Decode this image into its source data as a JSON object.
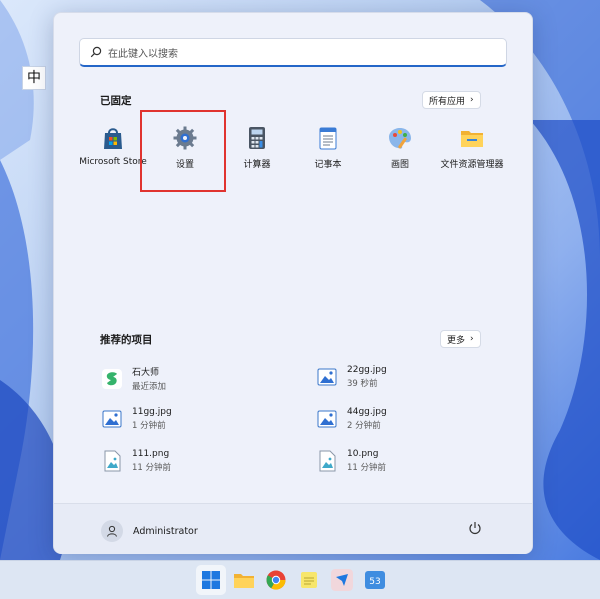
{
  "ime": {
    "label": "中"
  },
  "search": {
    "placeholder": "在此键入以搜索"
  },
  "pinned": {
    "title": "已固定",
    "all_apps_label": "所有应用",
    "apps": [
      {
        "label": "Microsoft Store",
        "icon": "store-icon"
      },
      {
        "label": "设置",
        "icon": "gear-icon"
      },
      {
        "label": "计算器",
        "icon": "calculator-icon"
      },
      {
        "label": "记事本",
        "icon": "notepad-icon"
      },
      {
        "label": "画图",
        "icon": "paint-icon"
      },
      {
        "label": "文件资源管理器",
        "icon": "folder-icon"
      }
    ]
  },
  "recommended": {
    "title": "推荐的项目",
    "more_label": "更多",
    "items": [
      {
        "name": "石大师",
        "time": "最近添加",
        "icon": "app-icon"
      },
      {
        "name": "22gg.jpg",
        "time": "39 秒前",
        "icon": "image-file-icon"
      },
      {
        "name": "11gg.jpg",
        "time": "1 分钟前",
        "icon": "image-file-icon"
      },
      {
        "name": "44gg.jpg",
        "time": "2 分钟前",
        "icon": "image-file-icon"
      },
      {
        "name": "111.png",
        "time": "11 分钟前",
        "icon": "png-file-icon"
      },
      {
        "name": "10.png",
        "time": "11 分钟前",
        "icon": "png-file-icon"
      }
    ]
  },
  "footer": {
    "user": "Administrator"
  },
  "colors": {
    "accent": "#2466c8",
    "highlight": "#e0332f"
  }
}
